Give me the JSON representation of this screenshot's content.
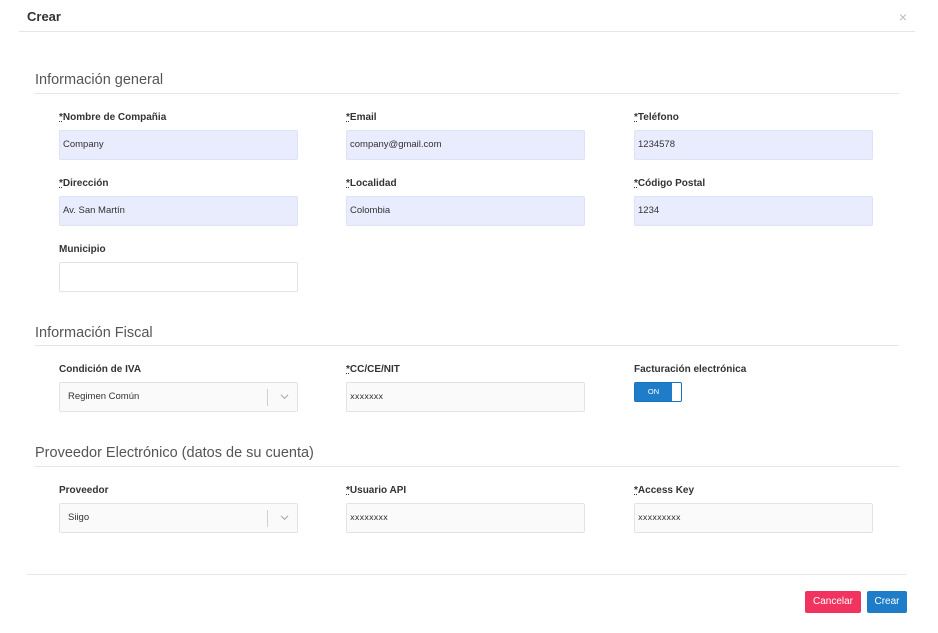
{
  "modal": {
    "title": "Crear",
    "close_glyph": "×"
  },
  "sections": {
    "general": {
      "title": "Información general"
    },
    "fiscal": {
      "title": "Información Fiscal"
    },
    "provider": {
      "title": "Proveedor Electrónico (datos de su cuenta)"
    }
  },
  "fields": {
    "company_name": {
      "label": "Nombre de Compañia",
      "required": true,
      "value": "Company"
    },
    "email": {
      "label": "Email",
      "required": true,
      "value": "company@gmail.com"
    },
    "phone": {
      "label": "Teléfono",
      "required": true,
      "value": "1234578"
    },
    "address": {
      "label": "Dirección",
      "required": true,
      "value": "Av. San Martín"
    },
    "locality": {
      "label": "Localidad",
      "required": true,
      "value": "Colombia"
    },
    "postal_code": {
      "label": "Código Postal",
      "required": true,
      "value": "1234"
    },
    "municipality": {
      "label": "Municipio",
      "required": false,
      "value": ""
    },
    "iva_condition": {
      "label": "Condición de IVA",
      "required": false,
      "value": "Regimen Común"
    },
    "nit": {
      "label": "CC/CE/NIT",
      "required": true,
      "value": "xxxxxxx"
    },
    "e_invoicing": {
      "label": "Facturación electrónica",
      "required": false,
      "toggle_label": "ON",
      "state": true
    },
    "provider": {
      "label": "Proveedor",
      "required": false,
      "value": "Siigo"
    },
    "api_user": {
      "label": "Usuario API",
      "required": true,
      "value": "xxxxxxxx"
    },
    "access_key": {
      "label": "Access Key",
      "required": true,
      "value": "xxxxxxxxx"
    }
  },
  "required_marker": "*",
  "footer": {
    "cancel_label": "Cancelar",
    "create_label": "Crear"
  },
  "colors": {
    "accent": "#1e7cc8",
    "danger": "#f0335f",
    "filled_input": "#e8ecfd"
  },
  "icons": {
    "close": "close-icon",
    "chevron": "chevron-down-icon"
  }
}
